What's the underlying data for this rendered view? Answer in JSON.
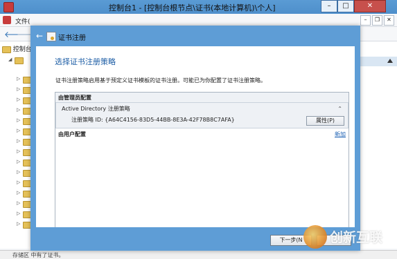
{
  "mmc": {
    "title": "控制台1 - [控制台根节点\\证书(本地计算机)\\个人]",
    "menu_file": "文件(",
    "tree_root": "控制台",
    "status": "存储区 中有了证书。"
  },
  "dialog": {
    "title": "证书注册",
    "heading": "选择证书注册策略",
    "description": "证书注册策略启用基于预定义证书模板的证书注册。可能已为你配置了证书注册策略。",
    "group_admin": "由管理员配置",
    "policy_name": "Active Directory 注册策略",
    "policy_id": "注册策略 ID:  {A64C4156-83D5-44BB-8E3A-42F78B8C7AFA}",
    "properties_button": "属性(P)",
    "group_user": "由用户配置",
    "add_link": "新加",
    "next_button": "下一步(N"
  },
  "watermark": {
    "text": "创新互联"
  },
  "colors": {
    "dialog_frame": "#5e9dd6",
    "heading": "#1c5da5",
    "link": "#1f63b5"
  }
}
